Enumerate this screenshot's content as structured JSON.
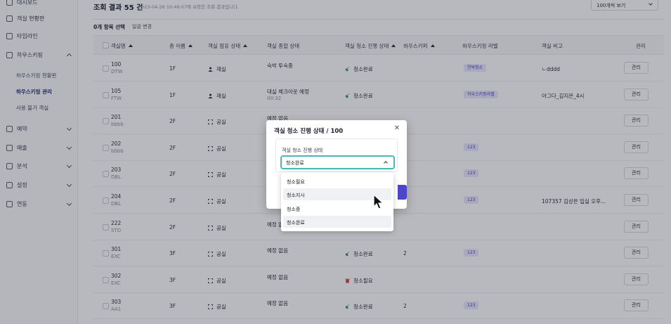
{
  "sidebar": {
    "top_cut": "대시보드",
    "items": [
      {
        "label": "객실 현황판"
      },
      {
        "label": "타임라인"
      },
      {
        "label": "하우스키핑"
      },
      {
        "label": "예약"
      },
      {
        "label": "매출"
      },
      {
        "label": "분석"
      },
      {
        "label": "설정"
      },
      {
        "label": "연동"
      }
    ],
    "sub": [
      {
        "label": "하우스키핑 현황판"
      },
      {
        "label": "하우스키핑 관리"
      },
      {
        "label": "사용 불가 객실"
      }
    ]
  },
  "header": {
    "title": "조회 결과 55 건",
    "note": "2023-04-26 10:46:07에 요청한 조회 결과입니다.",
    "per_page": "100개씩 보기"
  },
  "toolbar": {
    "selected": "0개 항목 선택",
    "bulk": "일괄 변경"
  },
  "columns": [
    "객실명",
    "층 이름",
    "객실 점유 상태",
    "객실 종합 상태",
    "객실 청소 진행 상태",
    "하우스키퍼",
    "하우스키핑 라벨",
    "객실 비고",
    "관리"
  ],
  "rows": [
    {
      "room": "100",
      "type": "DTW",
      "floor": "1F",
      "occ": "재실",
      "status": "숙박 투숙중",
      "status_sub": "",
      "clean": "청소완료",
      "keeper": "",
      "label": "연박청소",
      "memo": "ㄴdddd",
      "manage": "관리"
    },
    {
      "room": "105",
      "type": "FTW",
      "floor": "1F",
      "occ": "재실",
      "status": "대실 체크아웃 예정",
      "status_sub": "00:32",
      "clean": "청소완료",
      "keeper": "",
      "label": "하우스키핑라벨",
      "memo": "아그다_김지은_4시",
      "manage": "관리"
    },
    {
      "room": "201",
      "type": "bbbb",
      "floor": "2F",
      "occ": "공실",
      "status": "예정 없음",
      "status_sub": "",
      "clean": "",
      "keeper": "",
      "label": "",
      "memo": "",
      "manage": "관리"
    },
    {
      "room": "202",
      "type": "bbbb",
      "floor": "2F",
      "occ": "공실",
      "status": "",
      "status_sub": "",
      "clean": "",
      "keeper": "",
      "label": "123",
      "memo": "",
      "manage": "관리"
    },
    {
      "room": "203",
      "type": "DBL",
      "floor": "2F",
      "occ": "공실",
      "status": "",
      "status_sub": "",
      "clean": "",
      "keeper": "H",
      "label": "123",
      "memo": "",
      "manage": "관리"
    },
    {
      "room": "204",
      "type": "DBL",
      "floor": "2F",
      "occ": "공실",
      "status": "",
      "status_sub": "",
      "clean": "",
      "keeper": "",
      "label": "123",
      "memo": "107357 김상은 입실 오후...",
      "manage": "관리"
    },
    {
      "room": "222",
      "type": "STD",
      "floor": "2F",
      "occ": "공실",
      "status": "예정 없",
      "status_sub": "",
      "clean": "",
      "keeper": "",
      "label": "",
      "memo": "",
      "manage": "관리"
    },
    {
      "room": "301",
      "type": "EXC",
      "floor": "3F",
      "occ": "공실",
      "status": "예정 없음",
      "status_sub": "",
      "clean": "청소완료",
      "keeper": "2",
      "label": "123",
      "memo": "",
      "manage": "관리"
    },
    {
      "room": "302",
      "type": "EXC",
      "floor": "3F",
      "occ": "공실",
      "status": "예정 없음",
      "status_sub": "",
      "clean": "청소필요",
      "keeper": "",
      "label": "",
      "memo": "",
      "manage": "관리"
    },
    {
      "room": "303",
      "type": "AA1",
      "floor": "3F",
      "occ": "공실",
      "status": "예정 없음",
      "status_sub": "",
      "clean": "청소완료",
      "keeper": "2",
      "label": "123",
      "memo": "",
      "manage": "관리"
    }
  ],
  "modal": {
    "title": "객실 청소 진행 상태 / 100",
    "field_label": "객실 청소 진행 상태",
    "selected_value": "청소완료",
    "options": [
      "청소필요",
      "청소지시",
      "청소중",
      "청소완료"
    ]
  },
  "colors": {
    "accent": "#4a46c7",
    "focus": "#4bb8b8",
    "ok": "#2a8a4a",
    "need": "#d24040",
    "tag_bg": "#e8e7ff"
  }
}
